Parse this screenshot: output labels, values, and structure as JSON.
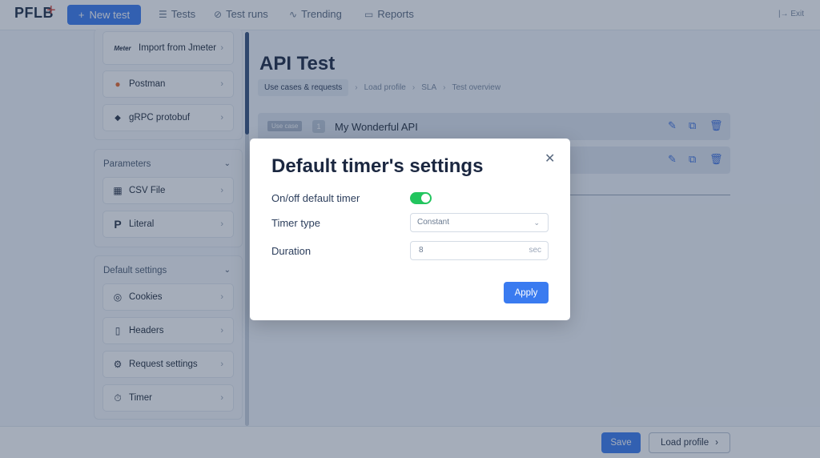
{
  "header": {
    "logo": "PFLB",
    "logo_mark": "+",
    "new_test_label": "New test",
    "nav": [
      {
        "label": "Tests"
      },
      {
        "label": "Test runs"
      },
      {
        "label": "Trending"
      },
      {
        "label": "Reports"
      }
    ],
    "exit_label": "Exit"
  },
  "sidebar": {
    "import_items": [
      {
        "label": "Import from Jmeter",
        "icon_text": "Meter"
      },
      {
        "label": "Postman"
      },
      {
        "label": "gRPC protobuf"
      }
    ],
    "parameters": {
      "title": "Parameters",
      "items": [
        {
          "label": "CSV File"
        },
        {
          "label": "Literal"
        }
      ]
    },
    "default_settings": {
      "title": "Default settings",
      "items": [
        {
          "label": "Cookies"
        },
        {
          "label": "Headers"
        },
        {
          "label": "Request settings"
        },
        {
          "label": "Timer"
        }
      ]
    }
  },
  "main": {
    "title": "API Test",
    "breadcrumbs": [
      "Use cases & requests",
      "Load profile",
      "SLA",
      "Test overview"
    ],
    "use_cases": [
      {
        "tag": "Use case",
        "number": "1",
        "name": "My Wonderful API"
      },
      {
        "tag": "",
        "number": "",
        "name": ""
      }
    ]
  },
  "footer": {
    "save_label": "Save",
    "next_label": "Load profile"
  },
  "modal": {
    "title": "Default timer's settings",
    "toggle_label": "On/off default timer",
    "toggle_on": true,
    "timer_type_label": "Timer type",
    "timer_type_value": "Constant",
    "duration_label": "Duration",
    "duration_value": "8",
    "duration_unit": "sec",
    "apply_label": "Apply"
  },
  "colors": {
    "accent": "#3a7bf0",
    "toggle_on": "#22c55e",
    "brand_mark": "#d94b3d"
  }
}
